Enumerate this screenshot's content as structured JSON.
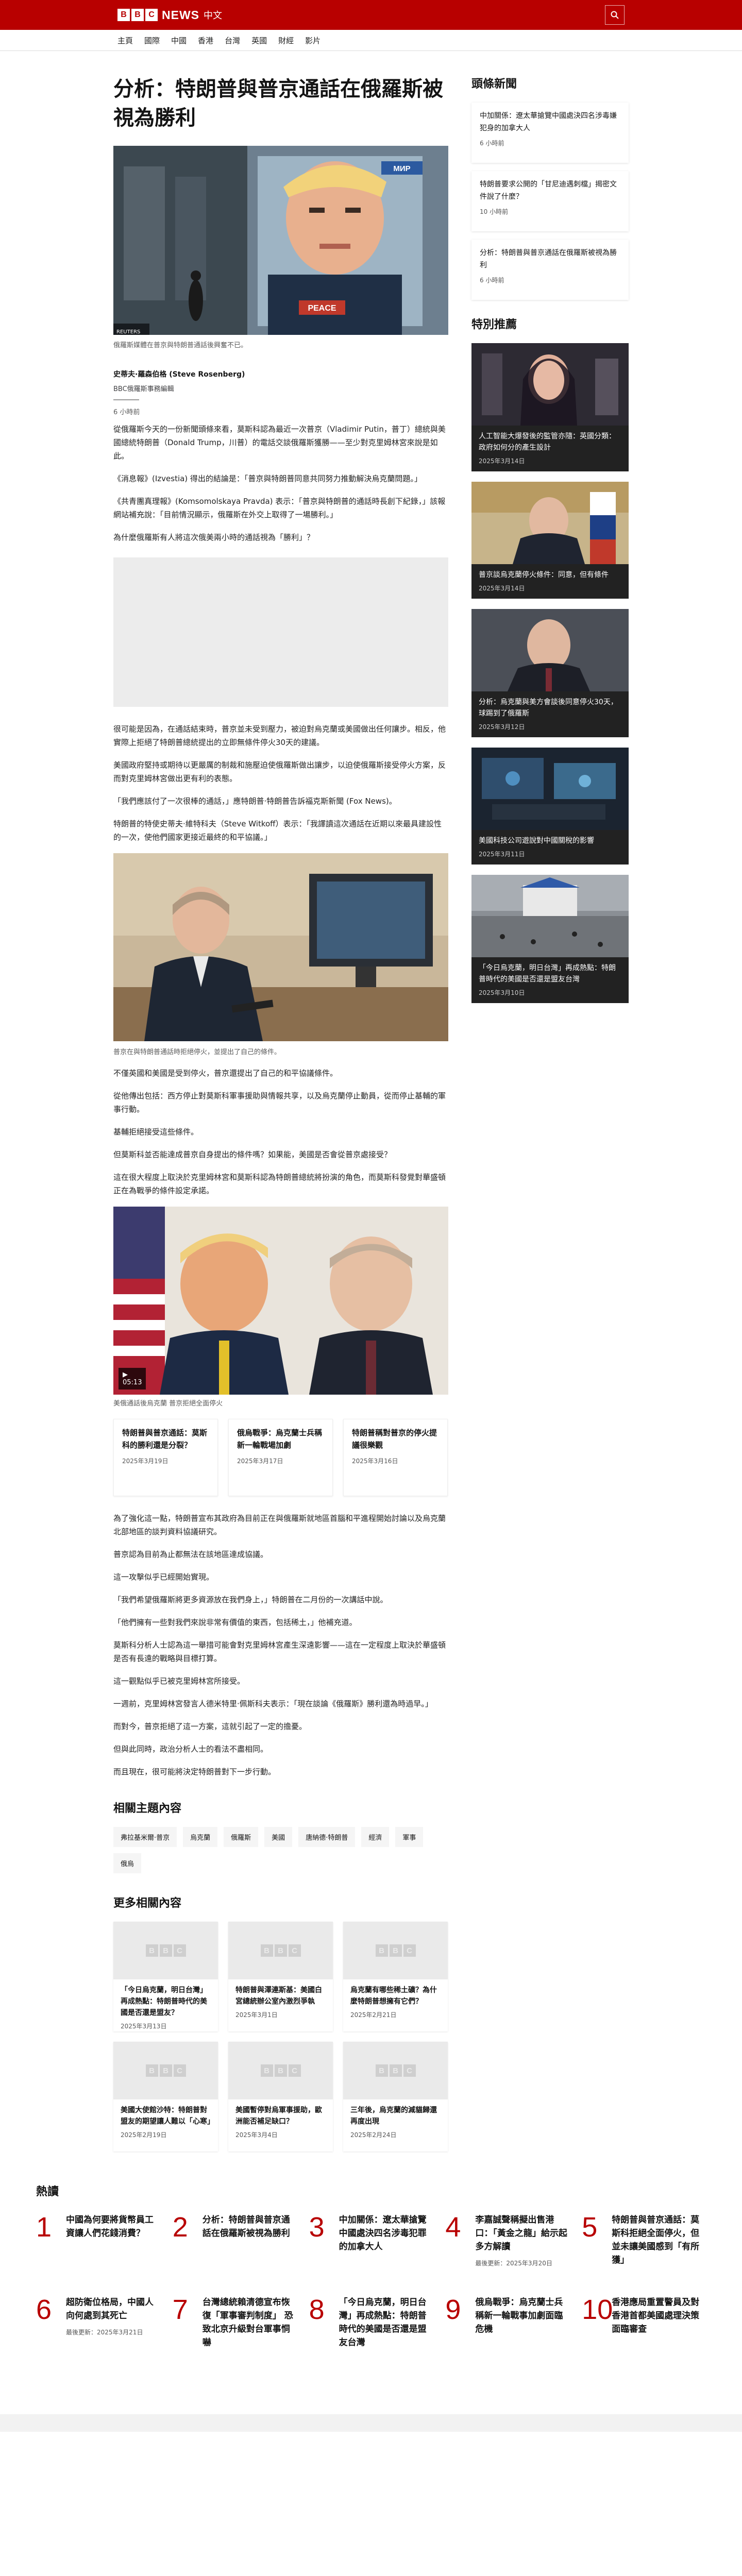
{
  "header": {
    "bbc_letters": [
      "B",
      "B",
      "C"
    ],
    "news": "NEWS",
    "lang": "中文",
    "nav": [
      "主頁",
      "國際",
      "中國",
      "香港",
      "台灣",
      "英國",
      "財經",
      "影片"
    ]
  },
  "article": {
    "headline": "分析：特朗普與普京通話在俄羅斯被視為勝利",
    "image_caption": "俄羅斯媒體在普京與特朗普通話後興奮不已。",
    "image_watermark": "REUTERS",
    "author": "史蒂夫·羅森伯格 (Steve Rosenberg)",
    "author_role": "BBC俄羅斯事務編輯",
    "time": "6 小時前",
    "paras1": [
      "從俄羅斯今天的一份新聞頭條來看，莫斯科認為最近一次普京（Vladimir Putin，普丁）總統與美國總統特朗普（Donald Trump，川普）的電話交談俄羅斯獲勝——至少對克里姆林宮來說是如此。",
      "《消息報》(Izvestia) 得出的結論是：「普京與特朗普同意共同努力推動解決烏克蘭問題。」",
      "《共青團真理報》(Komsomolskaya Pravda) 表示：「普京與特朗普的通話時長創下紀錄，」該報網站補充說：「目前情況顯示，俄羅斯在外交上取得了一場勝利。」",
      "為什麼俄羅斯有人將這次俄美兩小時的通話視為「勝利」？"
    ],
    "paras2": [
      "很可能是因為，在通話結束時，普京並未受到壓力，被迫對烏克蘭或美國做出任何讓步。相反，他實際上拒絕了特朗普總統提出的立即無條件停火30天的建議。",
      "美國政府堅持或期待以更嚴厲的制裁和施壓迫使俄羅斯做出讓步，以迫使俄羅斯接受停火方案，反而對克里姆林宮做出更有利的表態。",
      "「我們應該付了一次很棒的通話，」應特朗普·特朗普告訴福克斯新聞 (Fox News)。",
      "特朗普的特使史蒂夫·維特科夫（Steve Witkoff）表示：「我譯讀這次通話在近期以來最具建設性的一次，使他們國家更接近最終的和平協議。」"
    ],
    "image2_caption": "普京在與特朗普通話時拒絕停火，並提出了自己的條件。",
    "paras3": [
      "不僅英國和美國是受到停火，普京還提出了自己的和平協議條件。",
      "從他傳出包括：西方停止對莫斯科軍事援助與情報共享，以及烏克蘭停止動員，從而停止基輔的軍事行動。",
      "基輔拒絕接受這些條件。",
      "但莫斯科並否能達成普京自身提出的條件嗎？如果能，美國是否會從普京處接受？",
      "這在很大程度上取決於克里姆林宮和莫斯科認為特朗普總統將扮演的角色，而莫斯科發覺對華盛頓正在為戰爭的條件設定承諾。"
    ],
    "video_duration": "05:13",
    "video_caption": "美俄通話後烏克蘭 普京拒絕全面停火",
    "video_cards": [
      {
        "title": "特朗普與普京通話：莫斯科的勝利還是分裂？",
        "date": "2025年3月19日"
      },
      {
        "title": "俄烏戰爭：烏克蘭士兵稱新一輪戰場加劇",
        "date": "2025年3月17日"
      },
      {
        "title": "特朗普稱對普京的停火提議很樂觀",
        "date": "2025年3月16日"
      }
    ],
    "paras4": [
      "為了強化這一點，特朗普宣布其政府為目前正在與俄羅斯就地區首腦和平進程開始討論以及烏克蘭北部地區的談判資料協議研究。",
      "普京認為目前為止都無法在該地區達成協議。",
      "這一攻擊似乎已經開始實現。",
      "「我們希望俄羅斯將更多資源放在我們身上，」特朗普在二月份的一次講話中說。",
      "「他們擁有一些對我們來說非常有價值的東西，包括稀土，」他補充道。",
      "莫斯科分析人士認為這一舉措可能會對克里姆林宮產生深遠影響——這在一定程度上取決於華盛頓是否有長遠的戰略與目標打算。",
      "這一觀點似乎已被克里姆林宮所接受。",
      "一週前，克里姆林宮發言人德米特里·佩斯科夫表示：「現在談論《俄羅斯》勝利還為時過早。」",
      "而對今，普京拒絕了這一方案，這就引起了一定的擔憂。",
      "但與此同時，政治分析人士的看法不盡相同。",
      "而且現在，很可能將決定特朗普對下一步行動。"
    ],
    "related_topics_title": "相關主題內容",
    "related_topics": [
      "弗拉基米爾·普京",
      "烏克蘭",
      "俄羅斯",
      "美國",
      "唐納德·特朗普",
      "經濟",
      "軍事",
      "俄烏"
    ],
    "more_title": "更多相關內容",
    "more": [
      {
        "title": "「今日烏克蘭，明日台灣」再成熱點：特朗普時代的美國是否還是盟友？",
        "date": "2025年3月13日"
      },
      {
        "title": "特朗普與澤連斯基：美國白宮總統辦公室內激烈爭執",
        "date": "2025年3月1日"
      },
      {
        "title": "烏克蘭有哪些稀土礦？為什麼特朗普想擁有它們？",
        "date": "2025年2月21日"
      },
      {
        "title": "美國大使館沙特：特朗普對盟友的期望讓人難以「心寒」",
        "date": "2025年2月19日"
      },
      {
        "title": "美國暫停對烏軍事援助，歐洲能否補足缺口？",
        "date": "2025年3月4日"
      },
      {
        "title": "三年後，烏克蘭的減貓歸還再度出現",
        "date": "2025年2月24日"
      }
    ]
  },
  "sidebar": {
    "latest_title": "頭條新聞",
    "latest": [
      {
        "title": "中加關係：遼太華搶覽中國處決四名涉毒嫌犯身的加拿大人",
        "time": "6 小時前"
      },
      {
        "title": "特朗普要求公開的「甘尼迪遇刺檔」揭密文件說了什麼？",
        "time": "10 小時前"
      },
      {
        "title": "分析：特朗普與普京通話在俄羅斯被視為勝利",
        "time": "6 小時前"
      }
    ],
    "features_title": "特別推薦",
    "features": [
      {
        "title": "人工智能大爆發後的監管亦隨：英國分類：政府如何分的產生設計",
        "date": "2025年3月14日"
      },
      {
        "title": "普京談烏克蘭停火條件：同意，但有條件",
        "date": "2025年3月14日"
      },
      {
        "title": "分析：烏克蘭與美方會談後同意停火30天，球踢到了俄羅斯",
        "date": "2025年3月12日"
      },
      {
        "title": "美國科技公司遊說對中國關稅的影響",
        "date": "2025年3月11日"
      },
      {
        "title": "「今日烏克蘭，明日台灣」再成熱點：特朗普時代的美國是否還是盟友台灣",
        "date": "2025年3月10日"
      }
    ]
  },
  "mostread": {
    "title": "熱讀",
    "items": [
      {
        "num": "1",
        "text": "中國為何要將貨幣員工資讓人們花錢消費？",
        "date": ""
      },
      {
        "num": "2",
        "text": "分析：特朗普與普京通話在俄羅斯被視為勝利",
        "date": ""
      },
      {
        "num": "3",
        "text": "中加關係：遼太華搶覽中國處決四名涉毒犯罪的加拿大人",
        "date": ""
      },
      {
        "num": "4",
        "text": "李嘉誠聲稱擬出售港口：「黃金之龍」給示起多方解讀",
        "date": "最後更新：2025年3月20日"
      },
      {
        "num": "5",
        "text": "特朗普與普京通話：莫斯科拒絕全面停火，但並未讓美國感到「有所獲」",
        "date": ""
      },
      {
        "num": "6",
        "text": "超防衛位格局，中國人向何處到其死亡",
        "date": "最後更新：2025年3月21日"
      },
      {
        "num": "7",
        "text": "台灣總統賴清德宣布恢復「軍事審判制度」 恐致北京升級對台軍事恫嚇",
        "date": ""
      },
      {
        "num": "8",
        "text": "「今日烏克蘭，明日台灣」再成熱點：特朗普時代的美國是否還是盟友台灣",
        "date": ""
      },
      {
        "num": "9",
        "text": "俄烏戰爭：烏克蘭士兵稱新一輪戰事加劇面臨危機",
        "date": ""
      },
      {
        "num": "10",
        "text": "香港應局重置警員及對香港首都美國處理決策面臨審查",
        "date": ""
      }
    ]
  },
  "colors": {
    "brand_red": "#b80000",
    "number_red": "#b80000"
  }
}
